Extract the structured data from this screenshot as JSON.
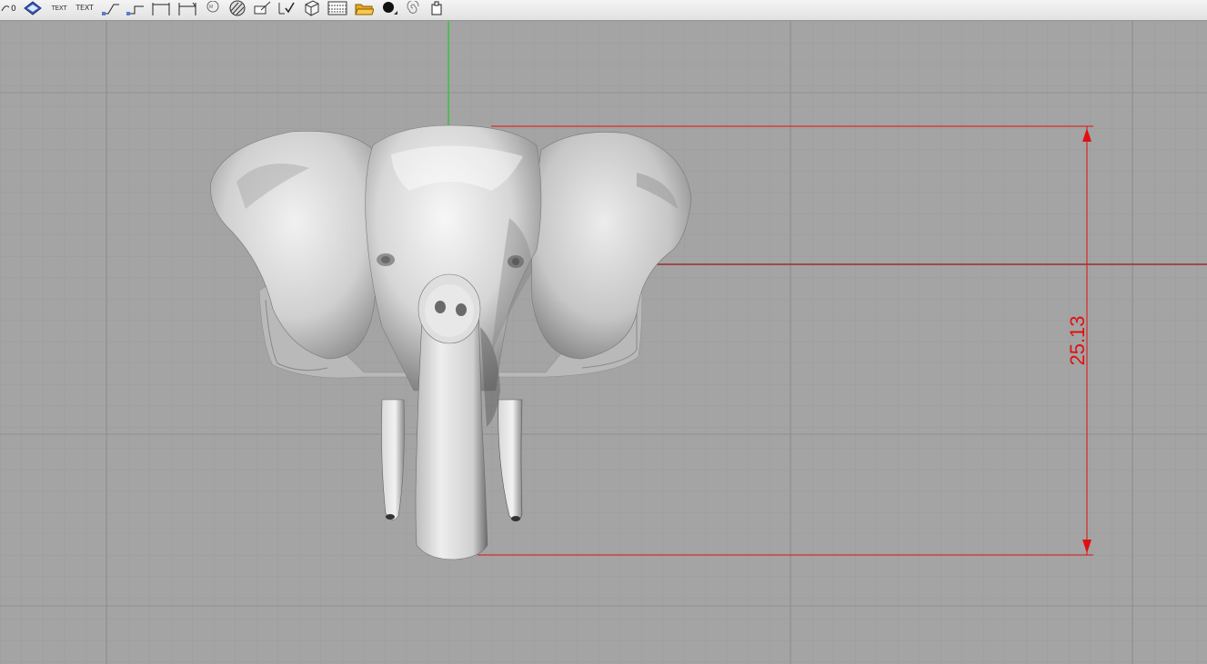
{
  "toolbar": {
    "items": [
      {
        "name": "dimension-zero-icon",
        "label": "0"
      },
      {
        "name": "diamond-icon",
        "label": ""
      },
      {
        "name": "text-small-tool",
        "label": "TEXT"
      },
      {
        "name": "text-tool",
        "label": "TEXT"
      },
      {
        "name": "leader-icon",
        "label": ""
      },
      {
        "name": "leader-curve-icon",
        "label": ""
      },
      {
        "name": "linear-dimension-icon",
        "label": ""
      },
      {
        "name": "aligned-dimension-icon",
        "label": ""
      },
      {
        "name": "stamp-icon",
        "label": ""
      },
      {
        "name": "hatch-icon",
        "label": ""
      },
      {
        "name": "pick-icon",
        "label": ""
      },
      {
        "name": "check-icon",
        "label": ""
      },
      {
        "name": "box-icon",
        "label": ""
      },
      {
        "name": "grid-icon",
        "label": ""
      },
      {
        "name": "folder-icon",
        "label": ""
      },
      {
        "name": "sphere-icon",
        "label": ""
      },
      {
        "name": "spiral-icon",
        "label": ""
      },
      {
        "name": "clipboard-icon",
        "label": ""
      }
    ]
  },
  "viewport": {
    "dimension_value": "25.13",
    "colors": {
      "background": "#a4a4a4",
      "grid_minor": "#9a9a9a",
      "grid_major": "#8e8e8e",
      "y_axis": "#1fcf1f",
      "x_axis": "#9a1414",
      "dimension": "#e01010"
    },
    "object": "elephant-head-model"
  }
}
